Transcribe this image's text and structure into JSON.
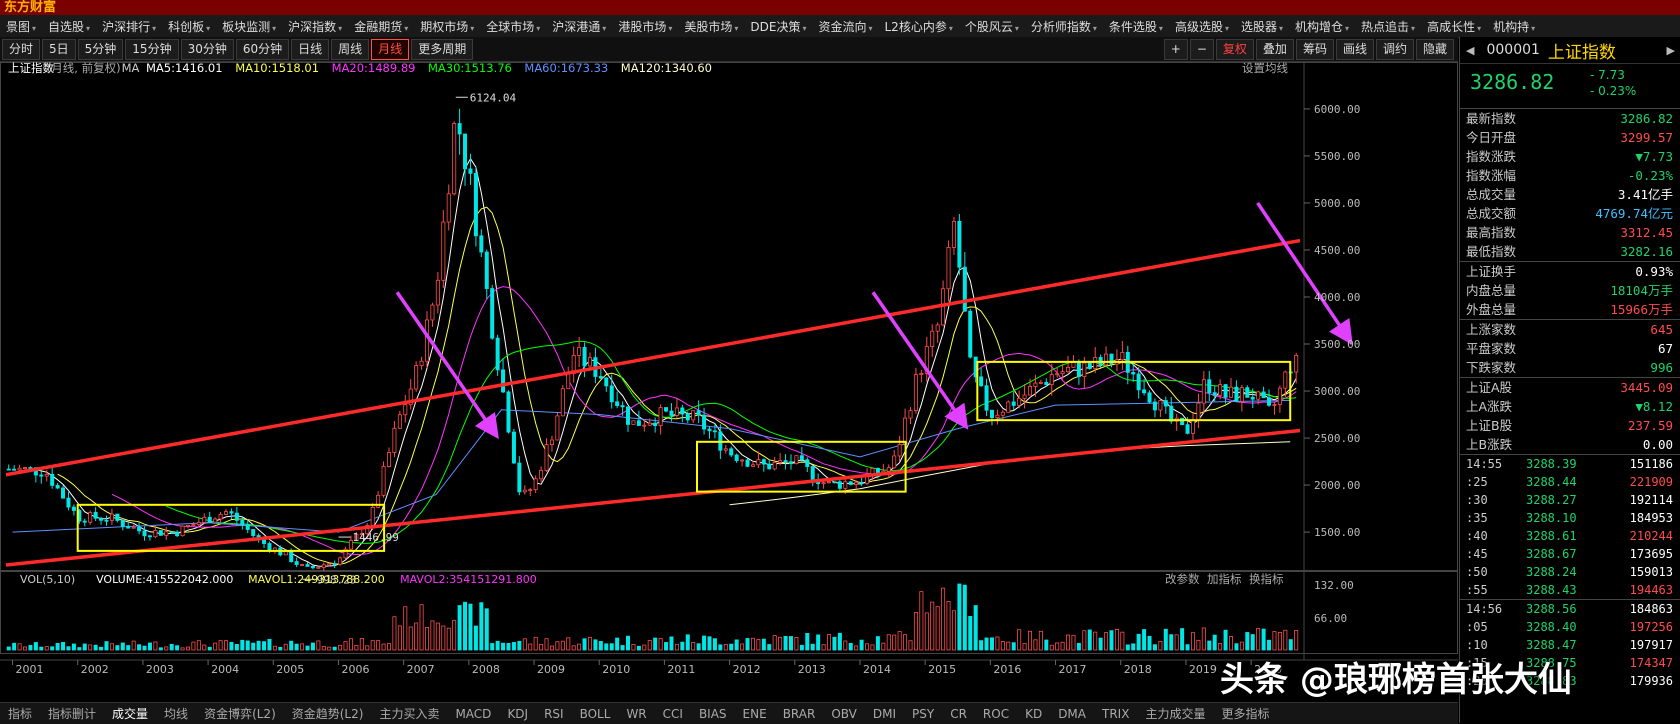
{
  "top_strip": {
    "brand": "东方财富"
  },
  "menu": {
    "items": [
      "景图",
      "自选股",
      "沪深排行",
      "科创板",
      "板块监测",
      "沪深指数",
      "金融期货",
      "期权市场",
      "全球市场",
      "沪深港通",
      "港股市场",
      "美股市场",
      "DDE决策",
      "资金流向",
      "L2核心内参",
      "个股风云",
      "分析师指数",
      "条件选股",
      "高级选股",
      "选股器",
      "机构增仓",
      "热点追击",
      "高成长性",
      "机构持"
    ]
  },
  "toolbar": {
    "periods": [
      "分时",
      "5日",
      "5分钟",
      "15分钟",
      "30分钟",
      "60分钟",
      "日线",
      "周线",
      "月线",
      "更多周期"
    ],
    "active_period": "月线",
    "right_buttons": [
      "+",
      "−",
      "复权",
      "叠加",
      "筹码",
      "画线",
      "调约",
      "隐藏"
    ]
  },
  "kline_header": {
    "name": "上证指数",
    "mode": "(月线, 前复权)",
    "ma_label": "MA",
    "ma5": "MA5:1416.01",
    "ma10": "MA10:1518.01",
    "ma20": "MA20:1489.89",
    "ma30": "MA30:1513.76",
    "ma60": "MA60:1673.33",
    "ma120": "MA120:1340.60",
    "settings": "设置均线"
  },
  "vol_header": {
    "label": "VOL(5,10)",
    "volume": "VOLUME:415522042.000",
    "mavol1": "MAVOL1:249313788.200",
    "mavol2": "MAVOL2:354151291.800",
    "links": [
      "改参数",
      "加指标",
      "换指标"
    ]
  },
  "colors": {
    "up": "#ff4c4c",
    "down": "#00e5e5",
    "ma5": "#ffffff",
    "ma10": "#ffff4a",
    "ma20": "#ff33ff",
    "ma30": "#00ff00",
    "ma60": "#6090ff",
    "ma120": "#ffffcc",
    "channel": "#ff2a2a",
    "box": "#ffff00",
    "arrow": "#e040ff"
  },
  "chart_data": {
    "type": "candlestick",
    "title": "上证指数 (月线, 前复权)",
    "y_ticks": [
      1500,
      2000,
      2500,
      3000,
      3500,
      4000,
      4500,
      5000,
      5500,
      6000
    ],
    "ylim": [
      1150,
      6350
    ],
    "x_ticks": [
      "2001",
      "2002",
      "2003",
      "2004",
      "2005",
      "2006",
      "2007",
      "2008",
      "2009",
      "2010",
      "2011",
      "2012",
      "2013",
      "2014",
      "2015",
      "2016",
      "2017",
      "2018",
      "2019",
      "2020"
    ],
    "xlim": [
      2000.9,
      2020.75
    ],
    "annotations": [
      {
        "label": "6124.04",
        "x": 2007.8,
        "y": 6124
      },
      {
        "label": "998.23",
        "x": 2005.45,
        "y": 998
      },
      {
        "label": "1446.99",
        "x": 2006.0,
        "y": 1447
      }
    ],
    "vol_ticks": [
      "132.00",
      "66.00"
    ],
    "vol_unit": "亿",
    "series": [
      {
        "name": "收盘",
        "x": [
          2001.0,
          2001.5,
          2002.0,
          2002.5,
          2003.0,
          2003.5,
          2004.0,
          2004.3,
          2004.8,
          2005.2,
          2005.5,
          2006.0,
          2006.5,
          2006.9,
          2007.2,
          2007.5,
          2007.8,
          2008.0,
          2008.4,
          2008.8,
          2009.0,
          2009.3,
          2009.6,
          2010.0,
          2010.5,
          2011.0,
          2011.5,
          2012.0,
          2012.5,
          2013.0,
          2013.5,
          2014.0,
          2014.5,
          2014.9,
          2015.2,
          2015.45,
          2015.7,
          2016.0,
          2016.5,
          2017.0,
          2017.5,
          2018.0,
          2018.3,
          2018.8,
          2019.0,
          2019.3,
          2019.6,
          2020.0,
          2020.3,
          2020.6
        ],
        "values": [
          2170,
          2150,
          1660,
          1650,
          1500,
          1500,
          1650,
          1720,
          1400,
          1250,
          1100,
          1200,
          1650,
          2650,
          3200,
          4100,
          5950,
          5300,
          3500,
          1850,
          2000,
          2600,
          3400,
          3200,
          2650,
          2750,
          2700,
          2350,
          2200,
          2250,
          2000,
          2050,
          2200,
          3200,
          3700,
          4800,
          3200,
          2750,
          2950,
          3200,
          3250,
          3350,
          3100,
          2650,
          2550,
          3100,
          2950,
          2980,
          2750,
          3286
        ]
      },
      {
        "name": "MA60",
        "x": [
          2001.0,
          2004.0,
          2006.0,
          2007.5,
          2008.5,
          2010.0,
          2012.0,
          2014.0,
          2015.5,
          2017.0,
          2020.6
        ],
        "values": [
          1500,
          1600,
          1500,
          1900,
          2800,
          2750,
          2600,
          2300,
          2600,
          2850,
          2900
        ]
      },
      {
        "name": "MA120",
        "x": [
          2012.0,
          2013.0,
          2014.0,
          2015.0,
          2016.0,
          2017.0,
          2018.0,
          2019.0,
          2020.6
        ],
        "values": [
          1790,
          1870,
          1960,
          2100,
          2230,
          2310,
          2380,
          2420,
          2460
        ]
      }
    ],
    "overlay_lines": [
      {
        "name": "上轨",
        "from": [
          2000.9,
          2110
        ],
        "to": [
          2020.75,
          4600
        ]
      },
      {
        "name": "下轨",
        "from": [
          2000.9,
          1150
        ],
        "to": [
          2020.75,
          2580
        ]
      }
    ],
    "boxes": [
      {
        "from": [
          2002.0,
          1790
        ],
        "to": [
          2006.7,
          1300
        ]
      },
      {
        "from": [
          2011.5,
          2460
        ],
        "to": [
          2014.7,
          1930
        ]
      },
      {
        "from": [
          2015.8,
          3310
        ],
        "to": [
          2020.6,
          2690
        ]
      }
    ]
  },
  "sidebar": {
    "code": "000001",
    "name": "上证指数",
    "last": "3286.82",
    "change": "- 7.73",
    "change_pct": "- 0.23%",
    "quote_rows": [
      {
        "label": "最新指数",
        "value": "3286.82",
        "color": "#1fd36a"
      },
      {
        "label": "今日开盘",
        "value": "3299.57",
        "color": "#ff4c4c"
      },
      {
        "label": "指数涨跌",
        "value": "▼7.73",
        "color": "#1fd36a"
      },
      {
        "label": "指数涨幅",
        "value": "-0.23%",
        "color": "#1fd36a"
      },
      {
        "label": "总成交量",
        "value": "3.41亿手",
        "color": "#ffffff"
      },
      {
        "label": "总成交额",
        "value": "4769.74亿元",
        "color": "#40c0ff"
      },
      {
        "label": "最高指数",
        "value": "3312.45",
        "color": "#ff4c4c"
      },
      {
        "label": "最低指数",
        "value": "3282.16",
        "color": "#1fd36a"
      }
    ],
    "quote_rows2": [
      {
        "label": "上证换手",
        "value": "0.93%",
        "color": "#ffffff"
      },
      {
        "label": "内盘总量",
        "value": "18104万手",
        "color": "#1fd36a"
      },
      {
        "label": "外盘总量",
        "value": "15966万手",
        "color": "#ff4c4c"
      }
    ],
    "quote_rows3": [
      {
        "label": "上涨家数",
        "value": "645",
        "color": "#ff4c4c"
      },
      {
        "label": "平盘家数",
        "value": "67",
        "color": "#ffffff"
      },
      {
        "label": "下跌家数",
        "value": "996",
        "color": "#1fd36a"
      }
    ],
    "quote_rows4": [
      {
        "label": "上证A股",
        "value": "3445.09",
        "color": "#ff4c4c"
      },
      {
        "label": "上A涨跌",
        "value": "▼8.12",
        "color": "#1fd36a"
      },
      {
        "label": "上证B股",
        "value": "237.59",
        "color": "#ff4c4c"
      },
      {
        "label": "上B涨跌",
        "value": "0.00",
        "color": "#ffffff"
      }
    ],
    "ticks": [
      {
        "time": "14:55",
        "price": "3288.39",
        "qty": "151186",
        "color": "#ffffff"
      },
      {
        "time": ":25",
        "price": "3288.44",
        "qty": "221909",
        "color": "#ff4c4c"
      },
      {
        "time": ":30",
        "price": "3288.27",
        "qty": "192114",
        "color": "#ffffff"
      },
      {
        "time": ":35",
        "price": "3288.10",
        "qty": "184953",
        "color": "#ffffff"
      },
      {
        "time": ":40",
        "price": "3288.61",
        "qty": "210244",
        "color": "#ff4c4c"
      },
      {
        "time": ":45",
        "price": "3288.67",
        "qty": "173695",
        "color": "#ffffff"
      },
      {
        "time": ":50",
        "price": "3288.24",
        "qty": "159013",
        "color": "#ffffff"
      },
      {
        "time": ":55",
        "price": "3288.43",
        "qty": "194463",
        "color": "#ff4c4c"
      },
      {
        "time": "14:56",
        "price": "3288.56",
        "qty": "184863",
        "color": "#ffffff"
      },
      {
        "time": ":05",
        "price": "3288.40",
        "qty": "197256",
        "color": "#ff4c4c"
      },
      {
        "time": ":10",
        "price": "3288.47",
        "qty": "197917",
        "color": "#ffffff"
      },
      {
        "time": ":15",
        "price": "3288.75",
        "qty": "174347",
        "color": "#ff4c4c"
      },
      {
        "time": ":20",
        "price": "3288.83",
        "qty": "179936",
        "color": "#ffffff"
      }
    ]
  },
  "bottom": {
    "items": [
      "指标",
      "指标删计",
      "成交量",
      "均线",
      "资金博弈(L2)",
      "资金趋势(L2)",
      "主力买入卖",
      "MACD",
      "KDJ",
      "RSI",
      "BOLL",
      "WR",
      "CCI",
      "BIAS",
      "ENE",
      "BRAR",
      "OBV",
      "DMI",
      "PSY",
      "CR",
      "ROC",
      "KD",
      "DMA",
      "TRIX",
      "主力成交量",
      "更多指标"
    ]
  },
  "watermark": "头条 @琅琊榜首张大仙"
}
